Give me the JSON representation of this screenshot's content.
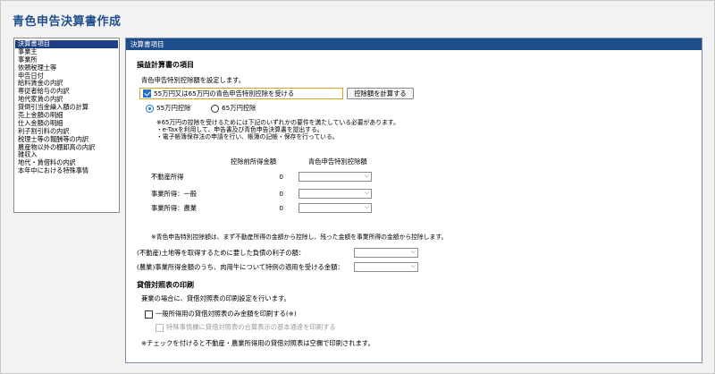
{
  "app": {
    "title": "青色申告決算書作成"
  },
  "nav": {
    "items": [
      "決算書項目",
      "事業主",
      "事業所",
      "依頼税理士等",
      "申告日付",
      "給料賃金の内訳",
      "専従者給与の内訳",
      "地代家賃の内訳",
      "貸倒引当金繰入額の計算",
      "売上金額の明細",
      "仕入金額の明細",
      "利子割引料の内訳",
      "税理士等の報酬等の内訳",
      "農産物以外の棚卸高の内訳",
      "雑収入",
      "地代・賃借料の内訳",
      "本年中における特殊事情"
    ],
    "selected_index": 0
  },
  "panel": {
    "header": "決算書項目",
    "profit": {
      "title": "損益計算書の項目",
      "desc": "青色申告特別控除額を設定します。",
      "checkbox_label": "55万円又は65万円の青色申告特別控除を受ける",
      "checkbox_checked": true,
      "calc_button": "控除額を計算する",
      "radio_55": "55万円控除",
      "radio_65": "65万円控除",
      "radio_selected": "55",
      "note_lines": [
        "※65万円の控除を受けるためには下記のいずれかの要件を満たしている必要があります。",
        "・e-Taxを利用して、申告書及び青色申告決算書を提出する。",
        "・電子帳簿保存法の申請を行い、帳簿の記帳・保存を行っている。"
      ]
    },
    "table": {
      "col_before": "控除前所得金額",
      "col_deduction": "青色申告特別控除額",
      "rows": [
        {
          "label": "不動産所得",
          "value": "0"
        },
        {
          "label": "事業所得：一般",
          "value": "0"
        },
        {
          "label": "事業所得：農業",
          "value": "0"
        }
      ]
    },
    "note2": "※青色申告特別控除額は、まず不動産所得の金額から控除し、残った金額を事業所得の金額から控除します。",
    "interest_label": "(不動産)土地等を取得するために要した負債の利子の額：",
    "beef_label": "(農業)事業所得金額のうち、肉用牛について特例の適用を受ける金額：",
    "balance": {
      "title": "貸借対照表の印刷",
      "desc": "兼業の場合に、貸借対照表の印刷設定を行います。",
      "cb1_label": "一般所得用の貸借対照表のみ金額を印刷する(※)",
      "cb2_label": "特殊事情欄に貸借対照表の合算表示の基本通達を印刷する",
      "note": "※チェックを付けると不動産・農業所得用の貸借対照表は空欄で印刷されます。"
    }
  }
}
